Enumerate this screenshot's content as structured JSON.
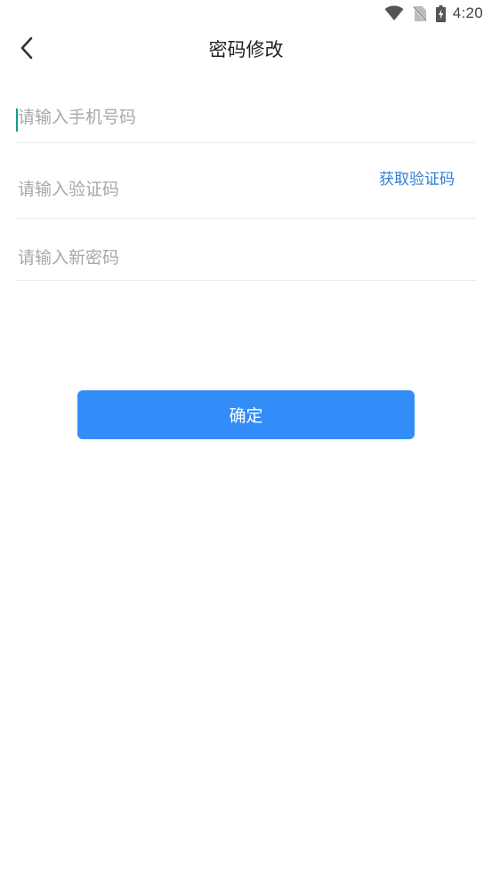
{
  "status_bar": {
    "time": "4:20",
    "icons": [
      "wifi-icon",
      "no-sim-icon",
      "battery-charging-icon"
    ]
  },
  "nav": {
    "back_icon": "chevron-left-icon",
    "title": "密码修改"
  },
  "form": {
    "phone_placeholder": "请输入手机号码",
    "code_placeholder": "请输入验证码",
    "get_code_label": "获取验证码",
    "password_placeholder": "请输入新密码"
  },
  "actions": {
    "confirm_label": "确定"
  },
  "colors": {
    "accent": "#338df9",
    "link": "#2f7ed8",
    "caret": "#1a9a88",
    "divider": "#ececec",
    "placeholder": "#a8a8a8"
  }
}
